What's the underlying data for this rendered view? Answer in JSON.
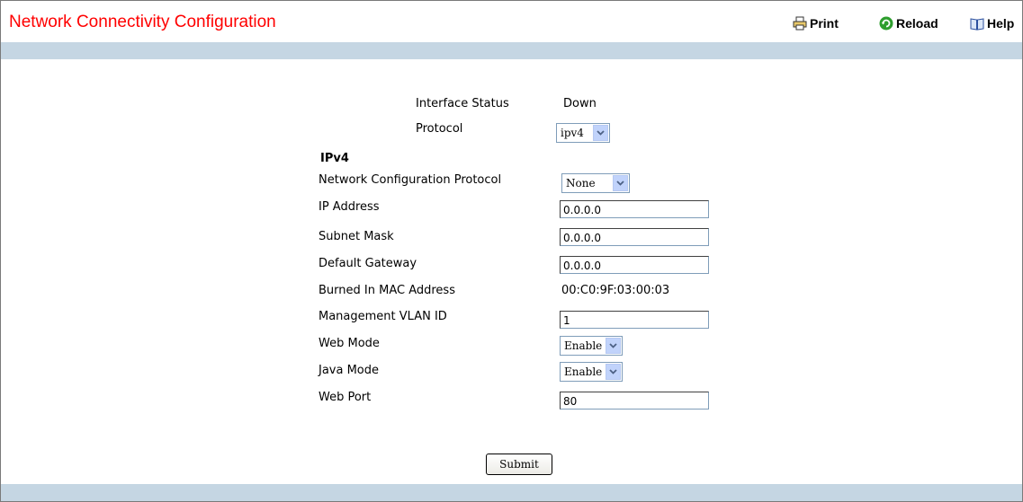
{
  "header": {
    "title": "Network Connectivity Configuration",
    "print_label": "Print",
    "reload_label": "Reload",
    "help_label": "Help"
  },
  "form": {
    "interface_status": {
      "label": "Interface Status",
      "value": "Down"
    },
    "protocol": {
      "label": "Protocol",
      "value": "ipv4"
    },
    "section_ipv4": "IPv4",
    "network_config_protocol": {
      "label": "Network Configuration Protocol",
      "value": "None"
    },
    "ip_address": {
      "label": "IP Address",
      "value": "0.0.0.0"
    },
    "subnet_mask": {
      "label": "Subnet Mask",
      "value": "0.0.0.0"
    },
    "default_gateway": {
      "label": "Default Gateway",
      "value": "0.0.0.0"
    },
    "burned_in_mac": {
      "label": "Burned In MAC Address",
      "value": "00:C0:9F:03:00:03"
    },
    "management_vlan_id": {
      "label": "Management VLAN ID",
      "value": "1"
    },
    "web_mode": {
      "label": "Web Mode",
      "value": "Enable"
    },
    "java_mode": {
      "label": "Java Mode",
      "value": "Enable"
    },
    "web_port": {
      "label": "Web Port",
      "value": "80"
    },
    "submit_label": "Submit"
  },
  "colors": {
    "title": "#ff0000",
    "band": "#c5d6e3",
    "reload_icon": "#2e9e2e"
  },
  "icons": {
    "print": "printer-icon",
    "reload": "reload-icon",
    "help": "book-icon",
    "dropdown": "chevron-down-icon"
  }
}
